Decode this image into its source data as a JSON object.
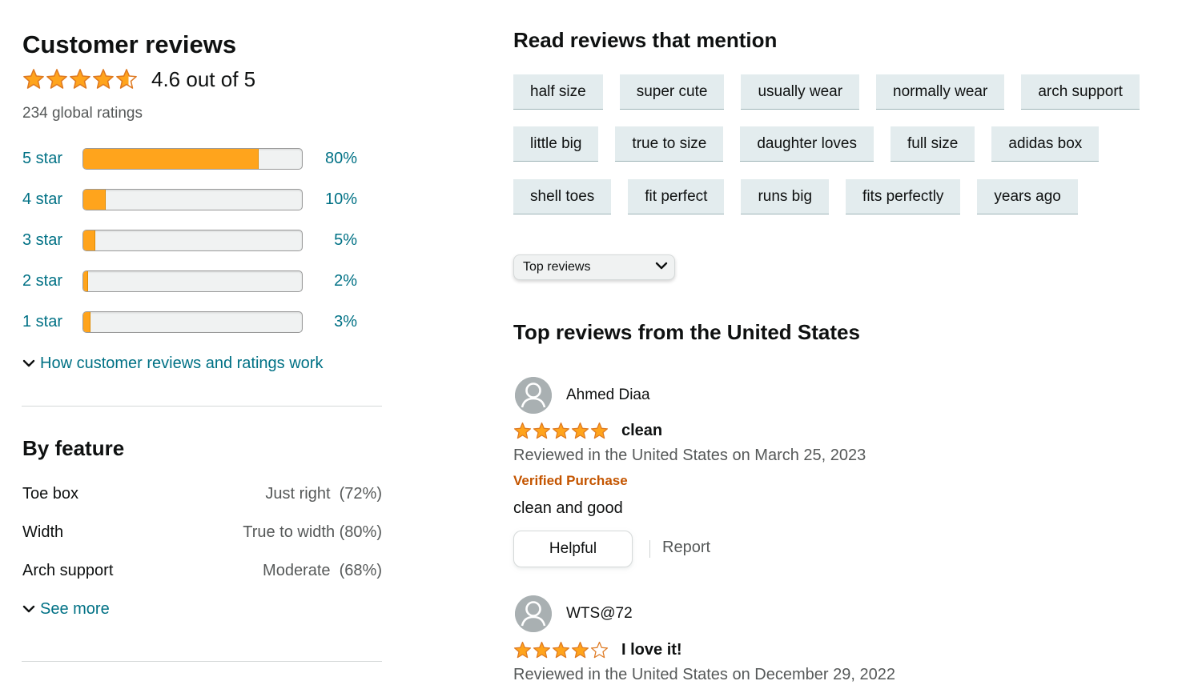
{
  "summary": {
    "title": "Customer reviews",
    "rating_value": 4.6,
    "rating_text": "4.6 out of 5",
    "global_ratings": "234 global ratings",
    "histogram": [
      {
        "label": "5 star",
        "percent": 80,
        "percent_text": "80%"
      },
      {
        "label": "4 star",
        "percent": 10,
        "percent_text": "10%"
      },
      {
        "label": "3 star",
        "percent": 5,
        "percent_text": "5%"
      },
      {
        "label": "2 star",
        "percent": 2,
        "percent_text": "2%"
      },
      {
        "label": "1 star",
        "percent": 3,
        "percent_text": "3%"
      }
    ],
    "how_link": "How customer reviews and ratings work"
  },
  "by_feature": {
    "title": "By feature",
    "items": [
      {
        "name": "Toe box",
        "value": "Just right  (72%)"
      },
      {
        "name": "Width",
        "value": "True to width (80%)"
      },
      {
        "name": "Arch support",
        "value": "Moderate  (68%)"
      }
    ],
    "see_more": "See more"
  },
  "mentions": {
    "title": "Read reviews that mention",
    "rows": [
      [
        "half size",
        "super cute",
        "usually wear",
        "normally wear",
        "arch support"
      ],
      [
        "little big",
        "true to size",
        "daughter loves",
        "full size",
        "adidas box"
      ],
      [
        "shell toes",
        "fit perfect",
        "runs big",
        "fits perfectly",
        "years ago"
      ]
    ]
  },
  "sort": {
    "selected": "Top reviews"
  },
  "reviews_heading": "Top reviews from the United States",
  "reviews": [
    {
      "name": "Ahmed Diaa",
      "rating": 5,
      "title": "clean",
      "date": "Reviewed in the United States on March 25, 2023",
      "verified": "Verified Purchase",
      "body": "clean and good",
      "helpful": "Helpful",
      "report": "Report"
    },
    {
      "name": "WTS@72",
      "rating": 4,
      "title": "I love it!",
      "date": "Reviewed in the United States on December 29, 2022"
    }
  ],
  "colors": {
    "star": "#ffa41c",
    "link": "#007185",
    "verified": "#c45500",
    "chip_bg": "#e3ecee"
  }
}
